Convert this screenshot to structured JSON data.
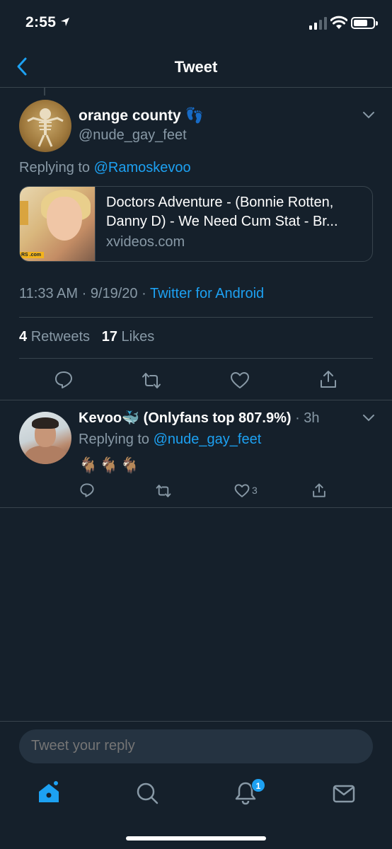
{
  "status_bar": {
    "time": "2:55"
  },
  "nav": {
    "title": "Tweet"
  },
  "tweet": {
    "author_name": "orange county 👣",
    "author_handle": "@nude_gay_feet",
    "replying_prefix": "Replying to",
    "replying_handle": "@Ramoskevoo",
    "card": {
      "title": "Doctors Adventure - (Bonnie Rotten, Danny D) - We Need Cum Stat - Br...",
      "domain": "xvideos.com",
      "thumb_badge": "RS .com"
    },
    "time": "11:33 AM",
    "date": "9/19/20",
    "source": "Twitter for Android",
    "retweets_count": "4",
    "retweets_label": "Retweets",
    "likes_count": "17",
    "likes_label": "Likes"
  },
  "reply": {
    "author_name": "Kevoo🐳 (Onlyfans top 807.9%)",
    "time": "· 3h",
    "replying_prefix": "Replying to",
    "replying_handle": "@nude_gay_feet",
    "text": "🐐🐐🐐",
    "like_count": "3"
  },
  "compose": {
    "placeholder": "Tweet your reply"
  },
  "tab_bar": {
    "notifications_badge": "1"
  },
  "colors": {
    "background": "#15202b",
    "accent": "#1da1f2",
    "muted": "#8899a6",
    "divider": "#38444d"
  },
  "icons": [
    "back-chevron-icon",
    "caret-down-icon",
    "reply-icon",
    "retweet-icon",
    "like-icon",
    "share-icon",
    "home-icon",
    "search-icon",
    "notifications-icon",
    "messages-icon"
  ]
}
